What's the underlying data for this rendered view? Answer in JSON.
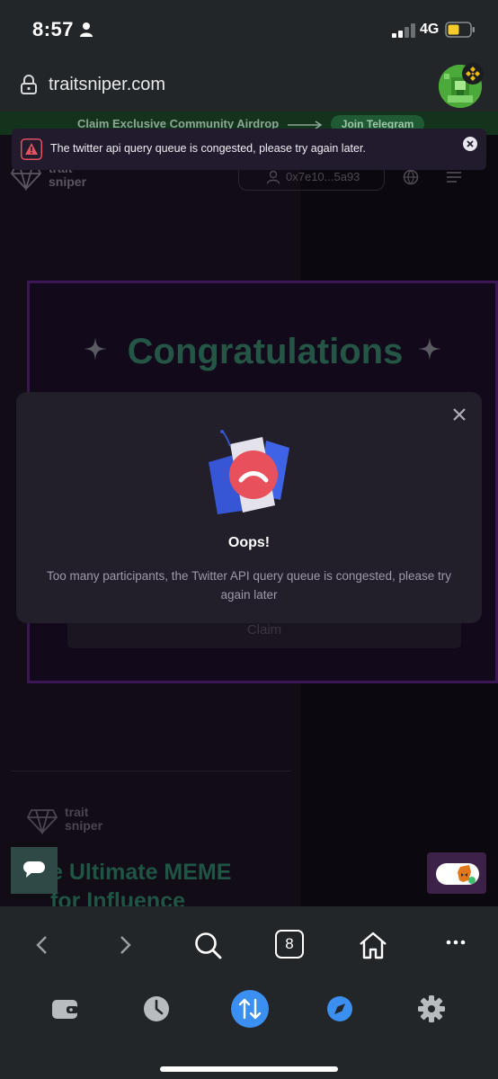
{
  "status_bar": {
    "time": "8:57",
    "network": "4G"
  },
  "browser": {
    "url": "traitsniper.com",
    "tabs_count": "8"
  },
  "page": {
    "promo": {
      "text": "Claim Exclusive Community Airdrop",
      "button": "Join Telegram"
    },
    "logo": {
      "line1": "trait",
      "line2": "sniper"
    },
    "address": "0x7e10...5a93",
    "congrats_title": "Congratulations",
    "claim_label": "Claim",
    "footer_logo": {
      "line1": "trait",
      "line2": "sniper"
    },
    "footer_tagline": {
      "line1": "e Ultimate MEME",
      "line2": "for Influence"
    }
  },
  "alert": {
    "message": "The twitter api query queue is congested, please try again later."
  },
  "modal": {
    "title": "Oops!",
    "message": "Too many participants, the Twitter API query queue is congested, please try again later"
  },
  "icons": {
    "status": [
      "person-icon",
      "signal-icon",
      "battery-icon"
    ],
    "toolbar": [
      "back-icon",
      "forward-icon",
      "search-icon",
      "tabs-icon",
      "home-icon",
      "more-icon"
    ],
    "dock": [
      "wallet-icon",
      "history-icon",
      "swap-icon",
      "discover-icon",
      "settings-icon"
    ]
  },
  "colors": {
    "chrome": "#232628",
    "accent_blue": "#3b8ff0",
    "congrats_green": "#245545",
    "modal_bg": "#221f2b",
    "alert_red": "#e05260"
  }
}
